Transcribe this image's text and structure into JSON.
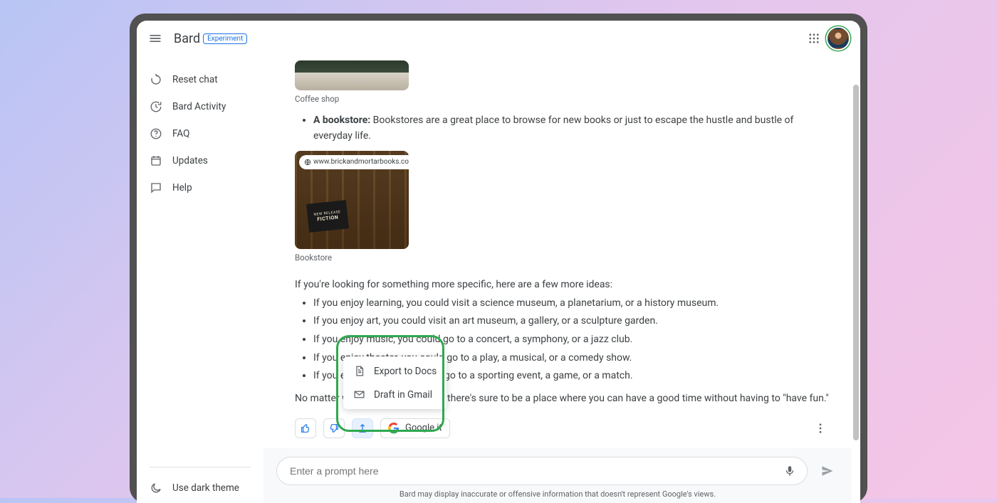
{
  "header": {
    "brand": "Bard",
    "badge": "Experiment"
  },
  "sidebar": {
    "items": [
      {
        "label": "Reset chat"
      },
      {
        "label": "Bard Activity"
      },
      {
        "label": "FAQ"
      },
      {
        "label": "Updates"
      },
      {
        "label": "Help"
      }
    ],
    "dark_theme_label": "Use dark theme"
  },
  "response": {
    "coffee_caption": "Coffee shop",
    "bookstore_bold": "A bookstore:",
    "bookstore_text": " Bookstores are a great place to browse for new books or just to escape the hustle and bustle of everyday life.",
    "bookstore_url": "www.brickandmortarbooks.com",
    "bookstore_caption": "Bookstore",
    "specific_intro": "If you're looking for something more specific, here are a few more ideas:",
    "ideas": [
      "If you enjoy learning, you could visit a science museum, a planetarium, or a history museum.",
      "If you enjoy art, you could visit an art museum, a gallery, or a sculpture garden.",
      "If you enjoy music, you could go to a concert, a symphony, or a jazz club.",
      "If you enjoy theater, you could go to a play, a musical, or a comedy show.",
      "If you enjoy sports, you could go to a sporting event, a game, or a match."
    ],
    "closing_a": "No matter what your interests are, there",
    "closing_b": "'s sure to be a place where you can have a good time without having to \"have fun.\"",
    "google_it_label": "Google it"
  },
  "export_menu": {
    "docs": "Export to Docs",
    "gmail": "Draft in Gmail"
  },
  "composer": {
    "placeholder": "Enter a prompt here"
  },
  "footer": {
    "disclaimer": "Bard may display inaccurate or offensive information that doesn't represent Google's views."
  }
}
